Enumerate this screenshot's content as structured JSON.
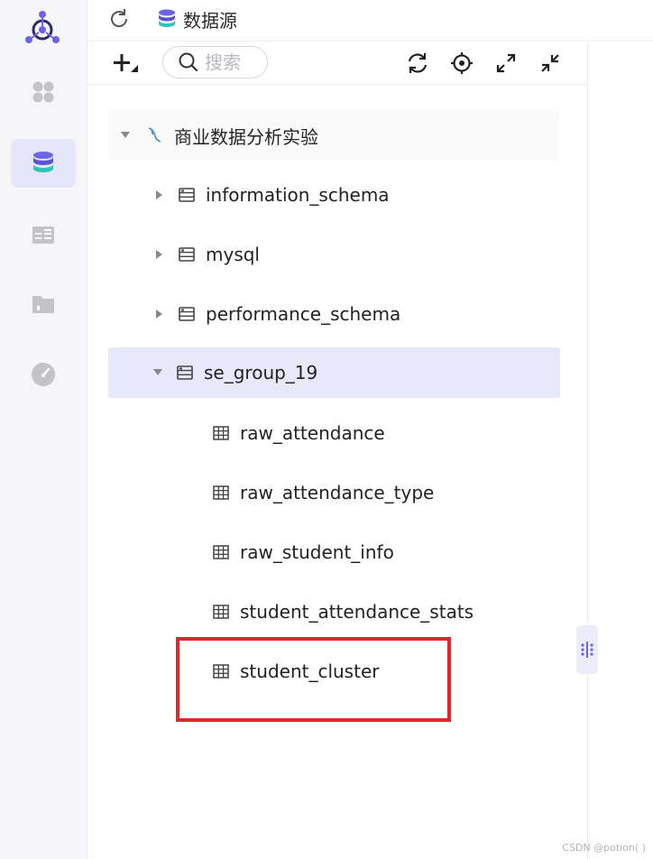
{
  "header": {
    "title": "数据源"
  },
  "sidebar": {
    "items": [
      {
        "name": "dashboard",
        "icon": "grid-icon",
        "active": false
      },
      {
        "name": "datasource",
        "icon": "database-icon",
        "active": true
      },
      {
        "name": "dataset",
        "icon": "table-icon",
        "active": false
      },
      {
        "name": "folder",
        "icon": "folder-icon",
        "active": false
      },
      {
        "name": "monitor",
        "icon": "gauge-icon",
        "active": false
      }
    ]
  },
  "toolbar": {
    "search_placeholder": "搜索",
    "buttons": [
      "add-icon",
      "refresh-icon",
      "locate-icon",
      "expand-icon",
      "collapse-icon"
    ]
  },
  "tree": {
    "root": {
      "label": "商业数据分析实验",
      "expanded": true
    },
    "schemas": [
      {
        "label": "information_schema",
        "expanded": false
      },
      {
        "label": "mysql",
        "expanded": false
      },
      {
        "label": "performance_schema",
        "expanded": false
      },
      {
        "label": "se_group_19",
        "expanded": true,
        "selected": true,
        "tables": [
          "raw_attendance",
          "raw_attendance_type",
          "raw_student_info",
          "student_attendance_stats",
          "student_cluster"
        ]
      }
    ]
  },
  "colors": {
    "accent": "#6c63e6",
    "selected_bg": "#e8e8fb",
    "highlight": "#e8232a"
  },
  "watermark": "CSDN @potion( )"
}
